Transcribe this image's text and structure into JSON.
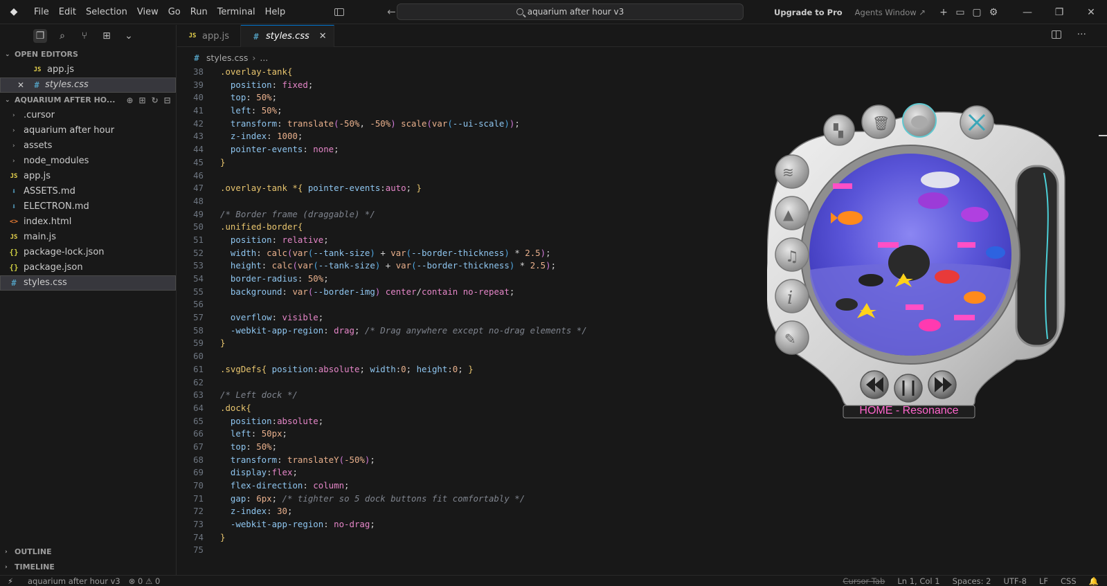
{
  "titlebar": {
    "menu": [
      "File",
      "Edit",
      "Selection",
      "View",
      "Go",
      "Run",
      "Terminal",
      "Help"
    ],
    "search": "aquarium after hour v3",
    "upgrade": "Upgrade to Pro",
    "agents": "Agents Window ↗"
  },
  "sidebar": {
    "open_editors_header": "OPEN EDITORS",
    "open_editors": [
      {
        "name": "app.js",
        "type": "js"
      },
      {
        "name": "styles.css",
        "type": "css"
      }
    ],
    "folder_header": "AQUARIUM AFTER HO...",
    "tree": [
      {
        "name": ".cursor",
        "type": "folder"
      },
      {
        "name": "aquarium after hour",
        "type": "folder"
      },
      {
        "name": "assets",
        "type": "folder"
      },
      {
        "name": "node_modules",
        "type": "folder"
      },
      {
        "name": "app.js",
        "type": "js"
      },
      {
        "name": "ASSETS.md",
        "type": "md"
      },
      {
        "name": "ELECTRON.md",
        "type": "md"
      },
      {
        "name": "index.html",
        "type": "html"
      },
      {
        "name": "main.js",
        "type": "js"
      },
      {
        "name": "package-lock.json",
        "type": "json"
      },
      {
        "name": "package.json",
        "type": "json"
      },
      {
        "name": "styles.css",
        "type": "css"
      }
    ],
    "outline_header": "OUTLINE",
    "timeline_header": "TIMELINE"
  },
  "tabs": [
    {
      "label": "app.js",
      "type": "js",
      "active": false
    },
    {
      "label": "styles.css",
      "type": "css",
      "active": true
    }
  ],
  "breadcrumbs": {
    "file": "styles.css",
    "more": "..."
  },
  "editor": {
    "lines": [
      {
        "n": "38",
        "segs": [
          [
            "sel",
            ".overlay-tank"
          ],
          [
            "br",
            "{"
          ]
        ]
      },
      {
        "n": "39",
        "segs": [
          [
            "punc",
            "  "
          ],
          [
            "prop",
            "position"
          ],
          [
            "punc",
            ": "
          ],
          [
            "kw",
            "fixed"
          ],
          [
            "punc",
            ";"
          ]
        ]
      },
      {
        "n": "40",
        "segs": [
          [
            "punc",
            "  "
          ],
          [
            "prop",
            "top"
          ],
          [
            "punc",
            ": "
          ],
          [
            "num",
            "50%"
          ],
          [
            "punc",
            ";"
          ]
        ]
      },
      {
        "n": "41",
        "segs": [
          [
            "punc",
            "  "
          ],
          [
            "prop",
            "left"
          ],
          [
            "punc",
            ": "
          ],
          [
            "num",
            "50%"
          ],
          [
            "punc",
            ";"
          ]
        ]
      },
      {
        "n": "42",
        "segs": [
          [
            "punc",
            "  "
          ],
          [
            "prop",
            "transform"
          ],
          [
            "punc",
            ": "
          ],
          [
            "fn",
            "translate"
          ],
          [
            "br2",
            "("
          ],
          [
            "num",
            "-50%"
          ],
          [
            "punc",
            ", "
          ],
          [
            "num",
            "-50%"
          ],
          [
            "br2",
            ")"
          ],
          [
            "punc",
            " "
          ],
          [
            "fn",
            "scale"
          ],
          [
            "br2",
            "("
          ],
          [
            "fn",
            "var"
          ],
          [
            "br3",
            "("
          ],
          [
            "var",
            "--ui-scale"
          ],
          [
            "br3",
            ")"
          ],
          [
            "br2",
            ")"
          ],
          [
            "punc",
            ";"
          ]
        ]
      },
      {
        "n": "43",
        "segs": [
          [
            "punc",
            "  "
          ],
          [
            "prop",
            "z-index"
          ],
          [
            "punc",
            ": "
          ],
          [
            "num",
            "1000"
          ],
          [
            "punc",
            ";"
          ]
        ]
      },
      {
        "n": "44",
        "segs": [
          [
            "punc",
            "  "
          ],
          [
            "prop",
            "pointer-events"
          ],
          [
            "punc",
            ": "
          ],
          [
            "kw",
            "none"
          ],
          [
            "punc",
            ";"
          ]
        ]
      },
      {
        "n": "45",
        "segs": [
          [
            "br",
            "}"
          ]
        ]
      },
      {
        "n": "46",
        "segs": []
      },
      {
        "n": "47",
        "segs": [
          [
            "sel",
            ".overlay-tank *"
          ],
          [
            "br",
            "{"
          ],
          [
            "punc",
            " "
          ],
          [
            "prop",
            "pointer-events"
          ],
          [
            "punc",
            ":"
          ],
          [
            "kw",
            "auto"
          ],
          [
            "punc",
            "; "
          ],
          [
            "br",
            "}"
          ]
        ]
      },
      {
        "n": "48",
        "segs": []
      },
      {
        "n": "49",
        "segs": [
          [
            "com",
            "/* Border frame (draggable) */"
          ]
        ]
      },
      {
        "n": "50",
        "segs": [
          [
            "sel",
            ".unified-border"
          ],
          [
            "br",
            "{"
          ]
        ]
      },
      {
        "n": "51",
        "segs": [
          [
            "punc",
            "  "
          ],
          [
            "prop",
            "position"
          ],
          [
            "punc",
            ": "
          ],
          [
            "kw",
            "relative"
          ],
          [
            "punc",
            ";"
          ]
        ]
      },
      {
        "n": "52",
        "segs": [
          [
            "punc",
            "  "
          ],
          [
            "prop",
            "width"
          ],
          [
            "punc",
            ": "
          ],
          [
            "fn",
            "calc"
          ],
          [
            "br2",
            "("
          ],
          [
            "fn",
            "var"
          ],
          [
            "br3",
            "("
          ],
          [
            "var",
            "--tank-size"
          ],
          [
            "br3",
            ")"
          ],
          [
            "punc",
            " + "
          ],
          [
            "fn",
            "var"
          ],
          [
            "br3",
            "("
          ],
          [
            "var",
            "--border-thickness"
          ],
          [
            "br3",
            ")"
          ],
          [
            "punc",
            " * "
          ],
          [
            "num",
            "2.5"
          ],
          [
            "br2",
            ")"
          ],
          [
            "punc",
            ";"
          ]
        ]
      },
      {
        "n": "53",
        "segs": [
          [
            "punc",
            "  "
          ],
          [
            "prop",
            "height"
          ],
          [
            "punc",
            ": "
          ],
          [
            "fn",
            "calc"
          ],
          [
            "br2",
            "("
          ],
          [
            "fn",
            "var"
          ],
          [
            "br3",
            "("
          ],
          [
            "var",
            "--tank-size"
          ],
          [
            "br3",
            ")"
          ],
          [
            "punc",
            " + "
          ],
          [
            "fn",
            "var"
          ],
          [
            "br3",
            "("
          ],
          [
            "var",
            "--border-thickness"
          ],
          [
            "br3",
            ")"
          ],
          [
            "punc",
            " * "
          ],
          [
            "num",
            "2.5"
          ],
          [
            "br2",
            ")"
          ],
          [
            "punc",
            ";"
          ]
        ]
      },
      {
        "n": "54",
        "segs": [
          [
            "punc",
            "  "
          ],
          [
            "prop",
            "border-radius"
          ],
          [
            "punc",
            ": "
          ],
          [
            "num",
            "50%"
          ],
          [
            "punc",
            ";"
          ]
        ]
      },
      {
        "n": "55",
        "segs": [
          [
            "punc",
            "  "
          ],
          [
            "prop",
            "background"
          ],
          [
            "punc",
            ": "
          ],
          [
            "fn",
            "var"
          ],
          [
            "br2",
            "("
          ],
          [
            "var",
            "--border-img"
          ],
          [
            "br2",
            ")"
          ],
          [
            "punc",
            " "
          ],
          [
            "kw",
            "center"
          ],
          [
            "punc",
            "/"
          ],
          [
            "kw",
            "contain"
          ],
          [
            "punc",
            " "
          ],
          [
            "kw",
            "no-repeat"
          ],
          [
            "punc",
            ";"
          ]
        ]
      },
      {
        "n": "56",
        "segs": []
      },
      {
        "n": "57",
        "segs": [
          [
            "punc",
            "  "
          ],
          [
            "prop",
            "overflow"
          ],
          [
            "punc",
            ": "
          ],
          [
            "kw",
            "visible"
          ],
          [
            "punc",
            ";"
          ]
        ]
      },
      {
        "n": "58",
        "segs": [
          [
            "punc",
            "  "
          ],
          [
            "prop",
            "-webkit-app-region"
          ],
          [
            "punc",
            ": "
          ],
          [
            "kw",
            "drag"
          ],
          [
            "punc",
            "; "
          ],
          [
            "com",
            "/* Drag anywhere except no-drag elements */"
          ]
        ]
      },
      {
        "n": "59",
        "segs": [
          [
            "br",
            "}"
          ]
        ]
      },
      {
        "n": "60",
        "segs": []
      },
      {
        "n": "61",
        "segs": [
          [
            "sel",
            ".svgDefs"
          ],
          [
            "br",
            "{"
          ],
          [
            "punc",
            " "
          ],
          [
            "prop",
            "position"
          ],
          [
            "punc",
            ":"
          ],
          [
            "kw",
            "absolute"
          ],
          [
            "punc",
            "; "
          ],
          [
            "prop",
            "width"
          ],
          [
            "punc",
            ":"
          ],
          [
            "num",
            "0"
          ],
          [
            "punc",
            "; "
          ],
          [
            "prop",
            "height"
          ],
          [
            "punc",
            ":"
          ],
          [
            "num",
            "0"
          ],
          [
            "punc",
            "; "
          ],
          [
            "br",
            "}"
          ]
        ]
      },
      {
        "n": "62",
        "segs": []
      },
      {
        "n": "63",
        "segs": [
          [
            "com",
            "/* Left dock */"
          ]
        ]
      },
      {
        "n": "64",
        "segs": [
          [
            "sel",
            ".dock"
          ],
          [
            "br",
            "{"
          ]
        ]
      },
      {
        "n": "65",
        "segs": [
          [
            "punc",
            "  "
          ],
          [
            "prop",
            "position"
          ],
          [
            "punc",
            ":"
          ],
          [
            "kw",
            "absolute"
          ],
          [
            "punc",
            ";"
          ]
        ]
      },
      {
        "n": "66",
        "segs": [
          [
            "punc",
            "  "
          ],
          [
            "prop",
            "left"
          ],
          [
            "punc",
            ": "
          ],
          [
            "num",
            "50px"
          ],
          [
            "punc",
            ";"
          ]
        ]
      },
      {
        "n": "67",
        "segs": [
          [
            "punc",
            "  "
          ],
          [
            "prop",
            "top"
          ],
          [
            "punc",
            ": "
          ],
          [
            "num",
            "50%"
          ],
          [
            "punc",
            ";"
          ]
        ]
      },
      {
        "n": "68",
        "segs": [
          [
            "punc",
            "  "
          ],
          [
            "prop",
            "transform"
          ],
          [
            "punc",
            ": "
          ],
          [
            "fn",
            "translateY"
          ],
          [
            "br2",
            "("
          ],
          [
            "num",
            "-50%"
          ],
          [
            "br2",
            ")"
          ],
          [
            "punc",
            ";"
          ]
        ]
      },
      {
        "n": "69",
        "segs": [
          [
            "punc",
            "  "
          ],
          [
            "prop",
            "display"
          ],
          [
            "punc",
            ":"
          ],
          [
            "kw",
            "flex"
          ],
          [
            "punc",
            ";"
          ]
        ]
      },
      {
        "n": "70",
        "segs": [
          [
            "punc",
            "  "
          ],
          [
            "prop",
            "flex-direction"
          ],
          [
            "punc",
            ": "
          ],
          [
            "kw",
            "column"
          ],
          [
            "punc",
            ";"
          ]
        ]
      },
      {
        "n": "71",
        "segs": [
          [
            "punc",
            "  "
          ],
          [
            "prop",
            "gap"
          ],
          [
            "punc",
            ": "
          ],
          [
            "num",
            "6px"
          ],
          [
            "punc",
            "; "
          ],
          [
            "com",
            "/* tighter so 5 dock buttons fit comfortably */"
          ]
        ]
      },
      {
        "n": "72",
        "segs": [
          [
            "punc",
            "  "
          ],
          [
            "prop",
            "z-index"
          ],
          [
            "punc",
            ": "
          ],
          [
            "num",
            "30"
          ],
          [
            "punc",
            ";"
          ]
        ]
      },
      {
        "n": "73",
        "segs": [
          [
            "punc",
            "  "
          ],
          [
            "prop",
            "-webkit-app-region"
          ],
          [
            "punc",
            ": "
          ],
          [
            "kw",
            "no-drag"
          ],
          [
            "punc",
            ";"
          ]
        ]
      },
      {
        "n": "74",
        "segs": [
          [
            "br",
            "}"
          ]
        ]
      },
      {
        "n": "75",
        "segs": []
      }
    ]
  },
  "statusbar": {
    "project": "aquarium after hour v3",
    "problems": "⊗ 0 ⚠ 0",
    "cursor_tab": "Cursor Tab",
    "position": "Ln 1, Col 1",
    "spaces": "Spaces: 2",
    "encoding": "UTF-8",
    "eol": "LF",
    "language": "CSS"
  },
  "aquarium": {
    "now_playing": "HOME - Resonance",
    "colors": {
      "frame": "#d8d8d8",
      "water": "#5a55d8",
      "label": "#ff66cc"
    },
    "dock_icons": [
      "fish-icon",
      "mountain-icon",
      "music-icon",
      "info-icon",
      "notes-icon"
    ],
    "top_icons": [
      "eraser-icon",
      "trash-icon",
      "bubble-icon",
      "close-icon"
    ],
    "controls": [
      "rewind-icon",
      "pause-icon",
      "forward-icon"
    ]
  }
}
